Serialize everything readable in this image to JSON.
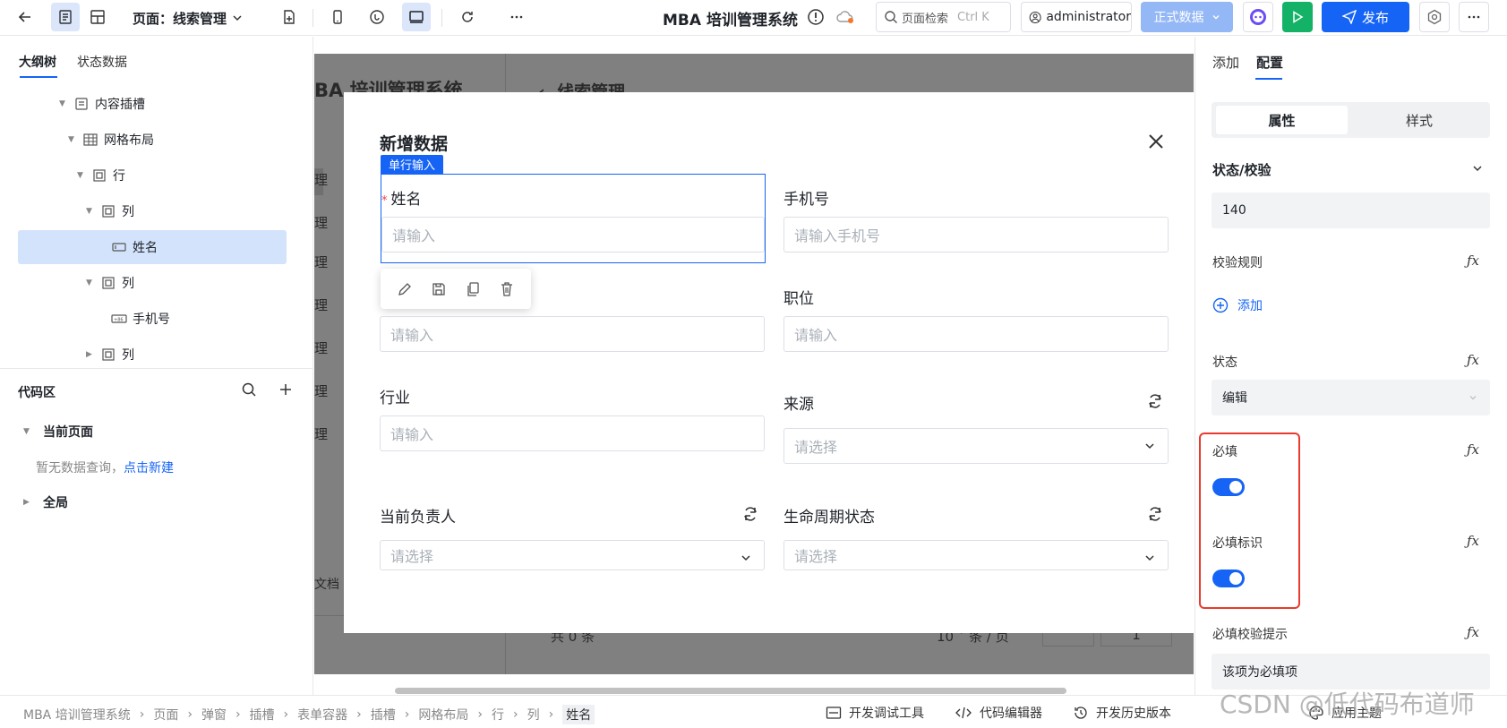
{
  "topbar": {
    "page_select": "页面：线索管理",
    "app_title": "MBA 培训管理系统",
    "search_placeholder": "页面检索",
    "search_shortcut": "Ctrl K",
    "user": "administrator",
    "env": "正式数据",
    "publish": "发布"
  },
  "left_panel": {
    "tabs": [
      "大纲树",
      "状态数据"
    ],
    "tree": [
      {
        "label": "内容插槽",
        "icon": "slot-icon"
      },
      {
        "label": "网格布局",
        "icon": "grid-icon"
      },
      {
        "label": "行",
        "icon": "row-icon"
      },
      {
        "label": "列",
        "icon": "column-icon"
      },
      {
        "label": "姓名",
        "icon": "input-icon"
      },
      {
        "label": "列",
        "icon": "column-icon"
      },
      {
        "label": "手机号",
        "icon": "phone-input-icon"
      },
      {
        "label": "列",
        "icon": "column-icon"
      }
    ],
    "code_area": {
      "title": "代码区",
      "current_page": "当前页面",
      "empty_text": "暂无数据查询，",
      "create_link": "点击新建",
      "global": "全局"
    }
  },
  "canvas_bg": {
    "app_name": "BA 培训管理系统",
    "breadcrumb": "线索管理",
    "side_items": [
      "理",
      "理",
      "理",
      "理",
      "理",
      "理",
      "理"
    ],
    "doc_text": "文档",
    "pagination": {
      "total": "共 0 条",
      "page_size": "10",
      "per_page": "条 / 页",
      "page": "1"
    }
  },
  "modal": {
    "title": "新增数据",
    "component_tag": "单行输入",
    "fields": [
      {
        "label": "姓名",
        "placeholder": "请输入",
        "required": true
      },
      {
        "label": "手机号",
        "placeholder": "请输入手机号"
      },
      {
        "label": "",
        "placeholder": "请输入"
      },
      {
        "label": "职位",
        "placeholder": "请输入"
      },
      {
        "label": "行业",
        "placeholder": "请输入"
      },
      {
        "label": "来源",
        "placeholder": "请选择"
      },
      {
        "label": "当前负责人",
        "placeholder": "请选择"
      },
      {
        "label": "生命周期状态",
        "placeholder": "请选择"
      }
    ]
  },
  "right_panel": {
    "tabs": [
      "添加",
      "配置"
    ],
    "segments": [
      "属性",
      "样式"
    ],
    "section_title": "状态/校验",
    "value": "140",
    "rules_label": "校验规则",
    "add_label": "添加",
    "state_label": "状态",
    "state_value": "编辑",
    "required_label": "必填",
    "required_on": true,
    "required_mark_label": "必填标识",
    "required_mark_on": true,
    "required_tip_label": "必填校验提示",
    "required_tip_value": "该项为必填项",
    "fx": "ƒx"
  },
  "footer": {
    "breadcrumbs": [
      "MBA 培训管理系统",
      "页面",
      "弹窗",
      "插槽",
      "表单容器",
      "插槽",
      "网格布局",
      "行",
      "列",
      "姓名"
    ],
    "tools": [
      "开发调试工具",
      "代码编辑器",
      "开发历史版本"
    ],
    "theme": "应用主题"
  },
  "watermark": "CSDN @低代码布道师",
  "colors": {
    "primary": "#1664f5",
    "run": "#14b266",
    "highlight": "#e83b2e",
    "selected_bg": "#d4e3fc"
  }
}
